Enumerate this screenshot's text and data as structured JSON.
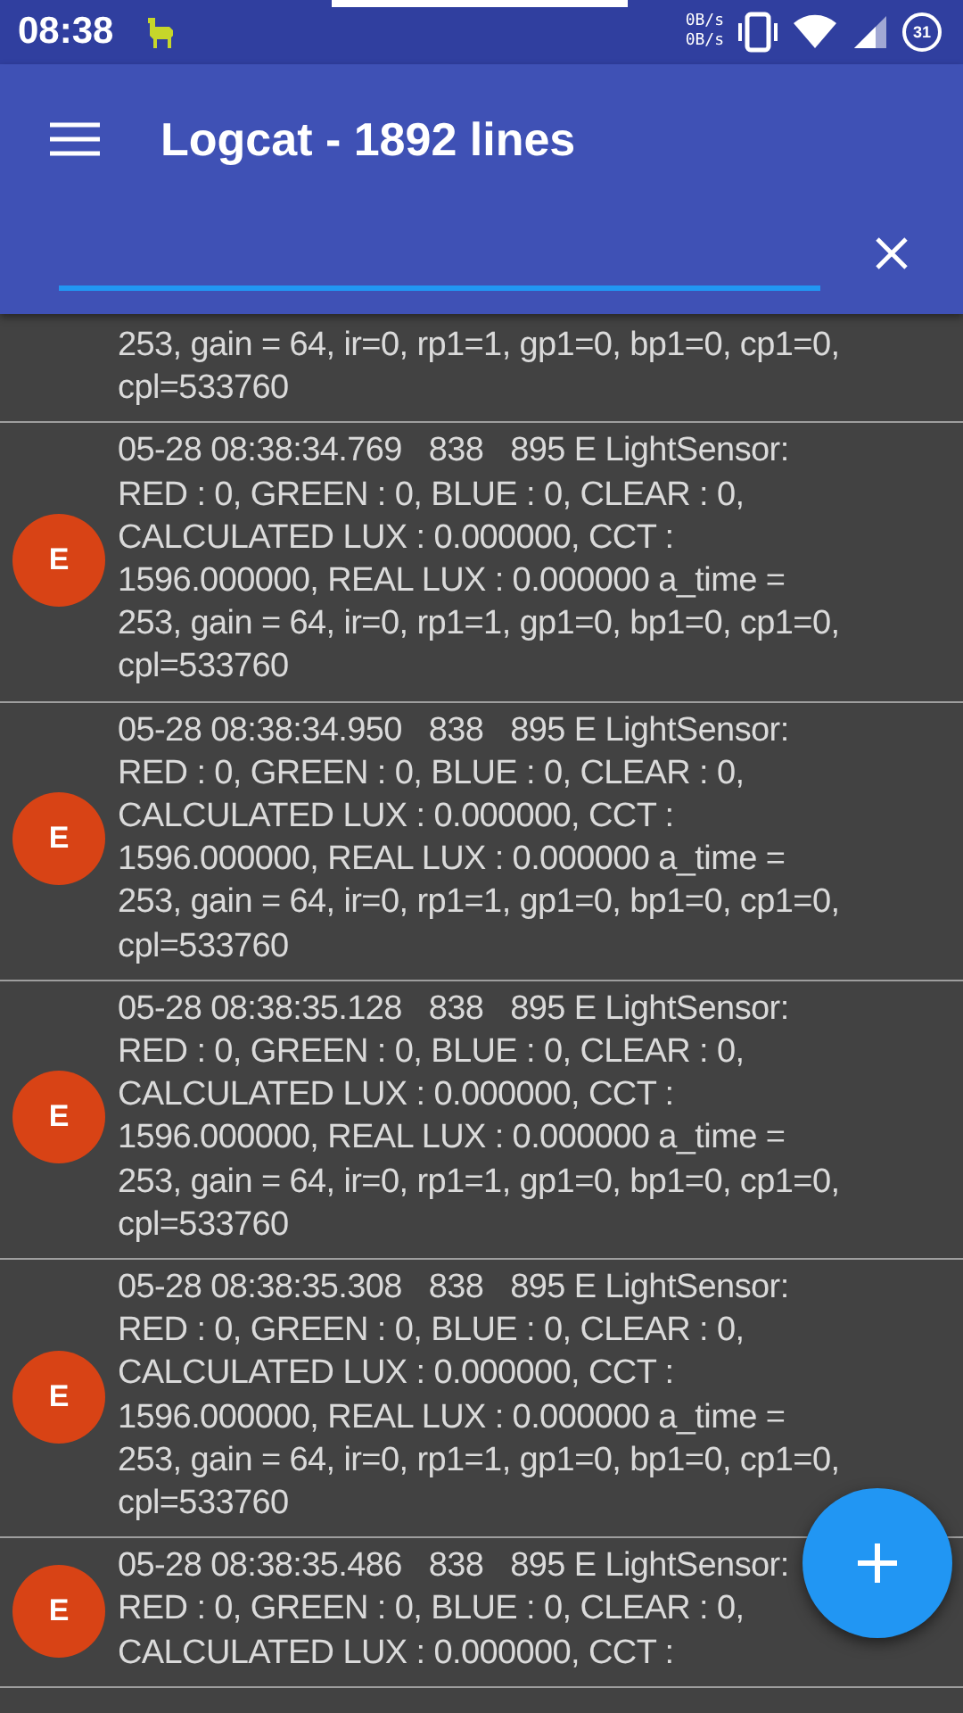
{
  "status_bar": {
    "time": "08:38",
    "net_up": "0B/s",
    "net_down": "0B/s",
    "battery": "31"
  },
  "toolbar": {
    "title": "Logcat - 1892 lines"
  },
  "search": {
    "focused": true
  },
  "entries": [
    {
      "text": "253, gain = 64, ir=0, rp1=1, gp1=0, bp1=0, cp1=0,\ncpl=533760"
    },
    {
      "badge": "E",
      "color": "#d84315",
      "text": "05-28 08:38:34.769   838   895 E LightSensor:\nRED : 0, GREEN : 0, BLUE : 0, CLEAR : 0,\nCALCULATED LUX : 0.000000, CCT :\n1596.000000, REAL LUX : 0.000000 a_time =\n253, gain = 64, ir=0, rp1=1, gp1=0, bp1=0, cp1=0,\ncpl=533760"
    },
    {
      "badge": "E",
      "color": "#d84315",
      "text": "05-28 08:38:34.950   838   895 E LightSensor:\nRED : 0, GREEN : 0, BLUE : 0, CLEAR : 0,\nCALCULATED LUX : 0.000000, CCT :\n1596.000000, REAL LUX : 0.000000 a_time =\n253, gain = 64, ir=0, rp1=1, gp1=0, bp1=0, cp1=0,\ncpl=533760"
    },
    {
      "badge": "E",
      "color": "#d84315",
      "text": "05-28 08:38:35.128   838   895 E LightSensor:\nRED : 0, GREEN : 0, BLUE : 0, CLEAR : 0,\nCALCULATED LUX : 0.000000, CCT :\n1596.000000, REAL LUX : 0.000000 a_time =\n253, gain = 64, ir=0, rp1=1, gp1=0, bp1=0, cp1=0,\ncpl=533760"
    },
    {
      "badge": "E",
      "color": "#d84315",
      "text": "05-28 08:38:35.308   838   895 E LightSensor:\nRED : 0, GREEN : 0, BLUE : 0, CLEAR : 0,\nCALCULATED LUX : 0.000000, CCT :\n1596.000000, REAL LUX : 0.000000 a_time =\n253, gain = 64, ir=0, rp1=1, gp1=0, bp1=0, cp1=0,\ncpl=533760"
    },
    {
      "badge": "E",
      "color": "#d84315",
      "text": "05-28 08:38:35.486   838   895 E LightSensor:\nRED : 0, GREEN : 0, BLUE : 0, CLEAR : 0,\nCALCULATED LUX : 0.000000, CCT :"
    }
  ]
}
